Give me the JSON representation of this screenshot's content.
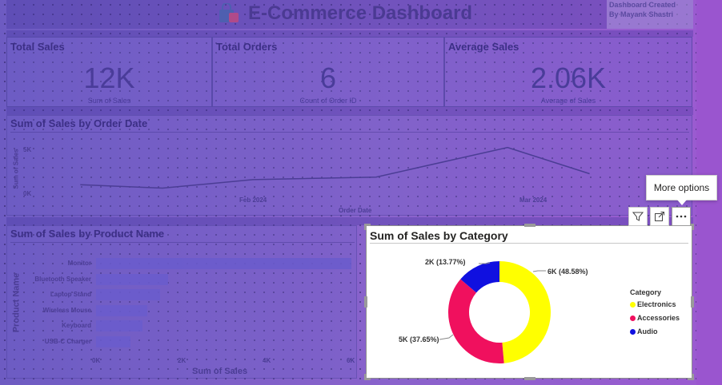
{
  "dashboard": {
    "title": "E-Commerce Dashboard",
    "credit_line1": "Dashboard Created",
    "credit_line2": "By Mayank Shastri"
  },
  "kpis": [
    {
      "title": "Total Sales",
      "value": "12K",
      "subtitle": "Sum of Sales"
    },
    {
      "title": "Total Orders",
      "value": "6",
      "subtitle": "Count of Order ID"
    },
    {
      "title": "Average Sales",
      "value": "2.06K",
      "subtitle": "Average of Sales"
    }
  ],
  "line_panel": {
    "title": "Sum of Sales by Order Date",
    "ylabel": "Sum of Sales",
    "xlabel": "Order Date",
    "y_ticks": [
      "5K",
      "0K"
    ],
    "x_ticks": [
      "Feb 2024",
      "Mar 2024"
    ]
  },
  "bar_panel": {
    "title": "Sum of Sales by Product Name",
    "ylabel": "Product Name",
    "xlabel": "Sum of Sales",
    "x_ticks": [
      "0K",
      "2K",
      "4K",
      "6K"
    ]
  },
  "donut_panel": {
    "title": "Sum of Sales by Category",
    "legend_title": "Category",
    "labels": {
      "electronics": "6K (48.58%)",
      "accessories": "5K (37.65%)",
      "audio": "2K (13.77%)"
    },
    "legend": [
      "Electronics",
      "Accessories",
      "Audio"
    ]
  },
  "toolbar": {
    "tooltip": "More options",
    "filter_icon": "filter-icon",
    "focus_icon": "focus-mode-icon",
    "more_icon": "more-options-icon"
  },
  "colors": {
    "electronics": "#ffff00",
    "accessories": "#f0105e",
    "audio": "#1010e0",
    "bar": "#6a5ccc",
    "line": "#4b3d95"
  },
  "chart_data": [
    {
      "type": "line",
      "title": "Sum of Sales by Order Date",
      "xlabel": "Order Date",
      "ylabel": "Sum of Sales",
      "x": [
        "2024-01-20",
        "2024-01-30",
        "2024-02-10",
        "2024-02-25",
        "2024-03-12",
        "2024-03-22"
      ],
      "values": [
        1200,
        800,
        1800,
        2100,
        5600,
        2500
      ],
      "ylim": [
        0,
        6000
      ],
      "x_ticks": [
        "Feb 2024",
        "Mar 2024"
      ],
      "y_ticks": [
        "0K",
        "5K"
      ]
    },
    {
      "type": "bar",
      "title": "Sum of Sales by Product Name",
      "xlabel": "Sum of Sales",
      "ylabel": "Product Name",
      "categories": [
        "Monitor",
        "Bluetooth Speaker",
        "Laptop Stand",
        "Wireless Mouse",
        "Keyboard",
        "USB-C Charger"
      ],
      "values": [
        6000,
        1700,
        1500,
        1200,
        1100,
        800
      ],
      "xlim": [
        0,
        6000
      ]
    },
    {
      "type": "pie",
      "title": "Sum of Sales by Category",
      "categories": [
        "Electronics",
        "Accessories",
        "Audio"
      ],
      "values": [
        48.58,
        37.65,
        13.77
      ],
      "labels": [
        "6K (48.58%)",
        "5K (37.65%)",
        "2K (13.77%)"
      ],
      "legend": "right"
    }
  ]
}
